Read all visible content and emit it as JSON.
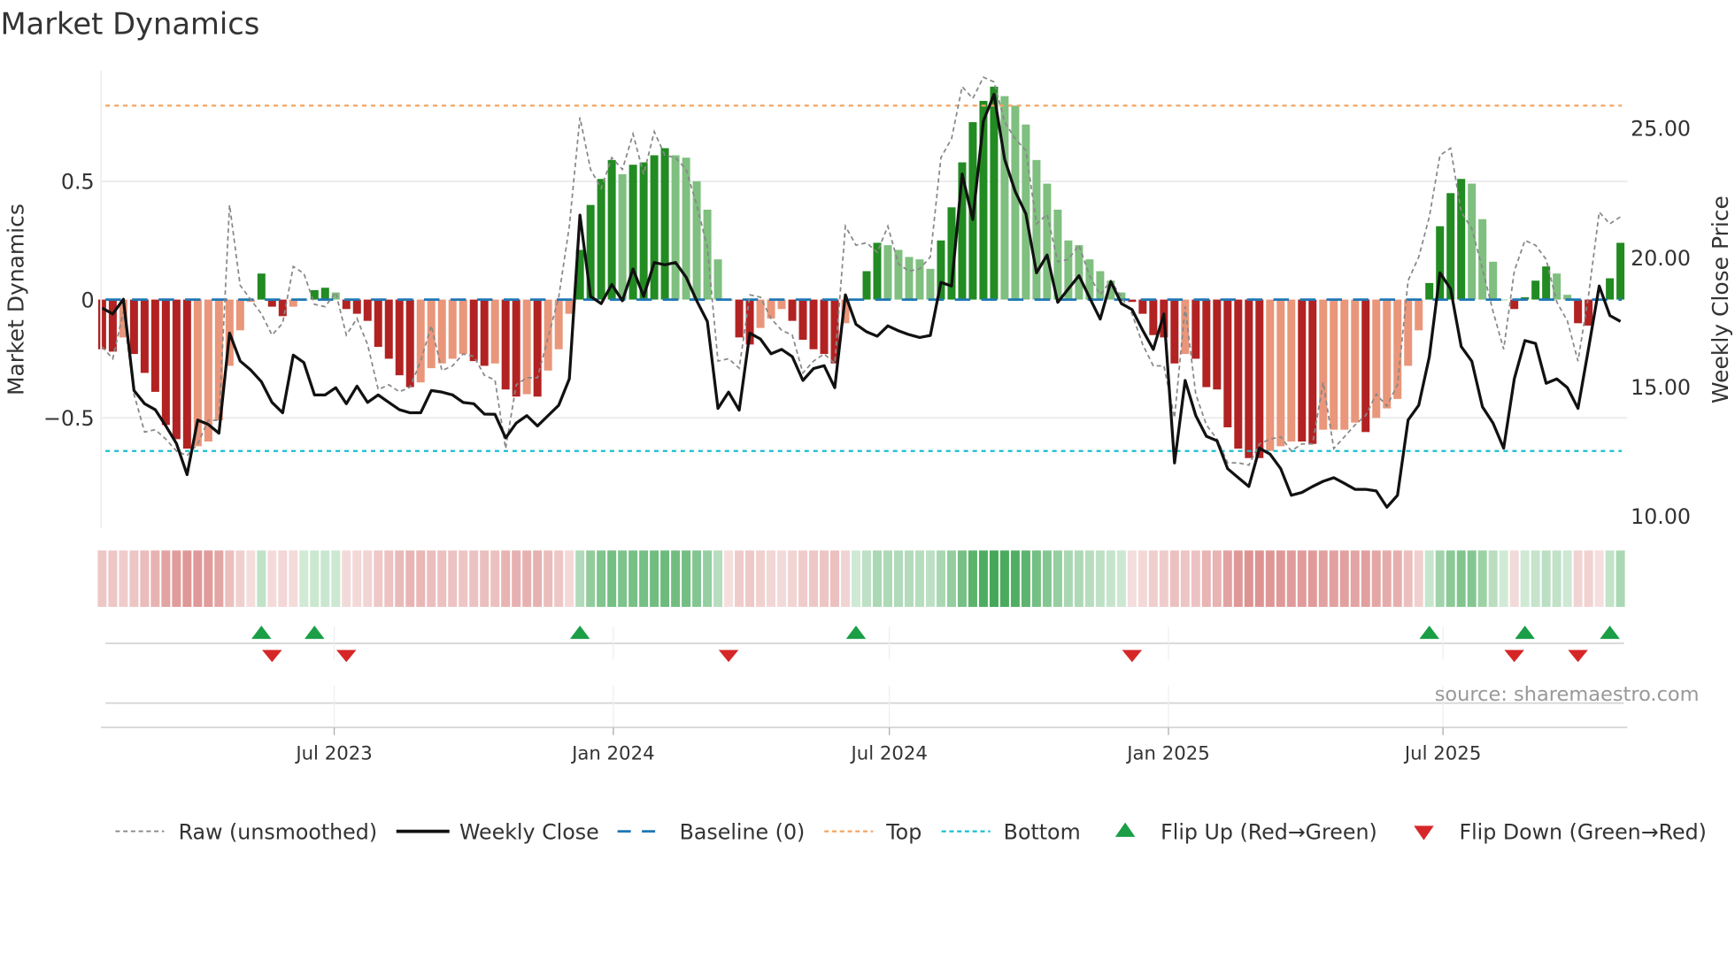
{
  "title": "Market Dynamics",
  "source": "source: sharemaestro.com",
  "colors": {
    "strong_red": "#b22222",
    "light_red": "#e9967a",
    "strong_green": "#228b22",
    "light_green": "#7fbf7f",
    "close": "#111111",
    "raw": "#888888",
    "baseline": "#1f77b4",
    "top": "#f4a460",
    "bottom": "#17becf",
    "flip_up": "#1a9e46",
    "flip_down": "#d62728"
  },
  "legend": [
    {
      "key": "raw",
      "label": "Raw (unsmoothed)"
    },
    {
      "key": "close",
      "label": "Weekly Close"
    },
    {
      "key": "baseline",
      "label": "Baseline (0)"
    },
    {
      "key": "top",
      "label": "Top"
    },
    {
      "key": "bottom",
      "label": "Bottom"
    },
    {
      "key": "flip_up",
      "label": "Flip Up (Red→Green)"
    },
    {
      "key": "flip_down",
      "label": "Flip Down (Green→Red)"
    }
  ],
  "chart_data": {
    "type": "bar",
    "title": "Market Dynamics",
    "ylabel": "Market Dynamics",
    "y2label": "Weekly Close Price",
    "ylim": [
      -0.97,
      0.97
    ],
    "y2lim": [
      9.53,
      27.22
    ],
    "yticks": [
      {
        "v": 0.5,
        "label": "0.5"
      },
      {
        "v": 0,
        "label": "0"
      },
      {
        "v": -0.5,
        "label": "−0.5"
      }
    ],
    "y2ticks": [
      {
        "v": 25,
        "label": "25.00"
      },
      {
        "v": 20,
        "label": "20.00"
      },
      {
        "v": 15,
        "label": "15.00"
      },
      {
        "v": 10,
        "label": "10.00"
      }
    ],
    "xticks": [
      {
        "date": "2023-07-01",
        "label": "Jul 2023"
      },
      {
        "date": "2024-01-01",
        "label": "Jan 2024"
      },
      {
        "date": "2024-07-01",
        "label": "Jul 2024"
      },
      {
        "date": "2025-01-01",
        "label": "Jan 2025"
      },
      {
        "date": "2025-07-01",
        "label": "Jul 2025"
      }
    ],
    "start_date": "2023-01-29",
    "frequency": "weekly",
    "top_level": 0.82,
    "bottom_level": -0.64,
    "baseline": 0,
    "values": [
      -0.21,
      -0.22,
      -0.16,
      -0.23,
      -0.31,
      -0.39,
      -0.53,
      -0.59,
      -0.63,
      -0.62,
      -0.6,
      -0.51,
      -0.28,
      -0.13,
      -0.01,
      0.11,
      -0.03,
      -0.07,
      -0.03,
      0.0,
      0.04,
      0.05,
      0.03,
      -0.04,
      -0.06,
      -0.09,
      -0.2,
      -0.25,
      -0.32,
      -0.37,
      -0.35,
      -0.29,
      -0.27,
      -0.25,
      -0.23,
      -0.26,
      -0.28,
      -0.27,
      -0.38,
      -0.41,
      -0.4,
      -0.41,
      -0.3,
      -0.21,
      -0.06,
      0.21,
      0.4,
      0.51,
      0.59,
      0.53,
      0.57,
      0.58,
      0.61,
      0.64,
      0.61,
      0.6,
      0.5,
      0.38,
      0.17,
      -0.003,
      -0.16,
      -0.19,
      -0.12,
      -0.08,
      -0.04,
      -0.09,
      -0.17,
      -0.21,
      -0.23,
      -0.27,
      -0.1,
      0.003,
      0.12,
      0.24,
      0.23,
      0.21,
      0.18,
      0.17,
      0.13,
      0.25,
      0.39,
      0.58,
      0.75,
      0.84,
      0.9,
      0.86,
      0.82,
      0.74,
      0.59,
      0.49,
      0.38,
      0.25,
      0.23,
      0.17,
      0.12,
      0.08,
      0.03,
      -0.01,
      -0.06,
      -0.15,
      -0.16,
      -0.27,
      -0.23,
      -0.25,
      -0.37,
      -0.38,
      -0.54,
      -0.63,
      -0.67,
      -0.67,
      -0.64,
      -0.62,
      -0.6,
      -0.6,
      -0.61,
      -0.55,
      -0.55,
      -0.55,
      -0.52,
      -0.56,
      -0.5,
      -0.46,
      -0.42,
      -0.28,
      -0.13,
      0.07,
      0.31,
      0.45,
      0.51,
      0.49,
      0.34,
      0.16,
      0.0,
      -0.04,
      0.01,
      0.08,
      0.14,
      0.11,
      0.02,
      -0.1,
      -0.11,
      -0.002,
      0.09,
      0.24
    ],
    "strong": [
      1,
      1,
      0,
      1,
      1,
      1,
      1,
      1,
      1,
      0,
      0,
      0,
      0,
      0,
      0,
      1,
      1,
      1,
      0,
      0,
      1,
      1,
      0,
      1,
      1,
      1,
      1,
      1,
      1,
      1,
      0,
      0,
      0,
      0,
      0,
      1,
      1,
      0,
      1,
      1,
      0,
      1,
      0,
      0,
      0,
      1,
      1,
      1,
      1,
      0,
      1,
      1,
      1,
      1,
      0,
      0,
      0,
      0,
      0,
      1,
      1,
      1,
      0,
      0,
      0,
      1,
      1,
      1,
      1,
      1,
      0,
      1,
      1,
      1,
      0,
      0,
      0,
      0,
      0,
      1,
      1,
      1,
      1,
      1,
      1,
      0,
      0,
      0,
      0,
      0,
      0,
      0,
      0,
      0,
      0,
      0,
      0,
      1,
      1,
      1,
      1,
      1,
      0,
      1,
      1,
      1,
      1,
      1,
      1,
      1,
      0,
      0,
      0,
      1,
      1,
      0,
      0,
      0,
      0,
      1,
      0,
      0,
      0,
      0,
      0,
      1,
      1,
      1,
      1,
      0,
      0,
      0,
      0,
      1,
      1,
      1,
      1,
      0,
      0,
      1,
      1,
      0,
      1,
      1
    ],
    "raw": [
      -0.2,
      -0.25,
      -0.05,
      -0.4,
      -0.56,
      -0.55,
      -0.59,
      -0.64,
      -0.66,
      -0.61,
      -0.51,
      -0.51,
      0.4,
      0.06,
      0.0,
      -0.06,
      -0.15,
      -0.1,
      0.14,
      0.11,
      -0.02,
      -0.03,
      0.03,
      -0.15,
      -0.08,
      -0.19,
      -0.38,
      -0.36,
      -0.39,
      -0.37,
      -0.26,
      -0.11,
      -0.3,
      -0.28,
      -0.23,
      -0.24,
      -0.32,
      -0.34,
      -0.63,
      -0.36,
      -0.33,
      -0.33,
      -0.16,
      0.01,
      0.31,
      0.77,
      0.55,
      0.47,
      0.6,
      0.55,
      0.7,
      0.53,
      0.71,
      0.61,
      0.6,
      0.55,
      0.4,
      0.22,
      -0.26,
      -0.25,
      -0.29,
      0.02,
      0.01,
      -0.08,
      -0.13,
      -0.15,
      -0.31,
      -0.26,
      -0.23,
      -0.27,
      0.31,
      0.23,
      0.24,
      0.2,
      0.31,
      0.15,
      0.12,
      0.13,
      0.18,
      0.6,
      0.68,
      0.9,
      0.85,
      0.94,
      0.92,
      0.75,
      0.68,
      0.63,
      0.32,
      0.36,
      0.16,
      0.17,
      0.23,
      0.1,
      0.02,
      0.08,
      0.01,
      -0.06,
      -0.19,
      -0.28,
      -0.28,
      -0.5,
      -0.03,
      -0.4,
      -0.53,
      -0.59,
      -0.69,
      -0.69,
      -0.7,
      -0.61,
      -0.59,
      -0.58,
      -0.64,
      -0.61,
      -0.61,
      -0.35,
      -0.63,
      -0.58,
      -0.53,
      -0.49,
      -0.4,
      -0.45,
      -0.36,
      0.08,
      0.18,
      0.35,
      0.61,
      0.64,
      0.37,
      0.3,
      0.13,
      -0.05,
      -0.21,
      0.12,
      0.25,
      0.23,
      0.17,
      -0.01,
      -0.09,
      -0.26,
      0.02,
      0.37,
      0.32,
      0.35
    ],
    "close": [
      18.05,
      17.82,
      18.39,
      14.86,
      14.35,
      14.12,
      13.49,
      12.81,
      11.61,
      13.72,
      13.55,
      13.21,
      17.08,
      16.0,
      15.65,
      15.2,
      14.4,
      14.0,
      16.23,
      15.94,
      14.69,
      14.69,
      14.97,
      14.35,
      15.03,
      14.4,
      14.69,
      14.4,
      14.12,
      14.0,
      14.0,
      14.86,
      14.8,
      14.69,
      14.4,
      14.35,
      13.95,
      13.94,
      13.03,
      13.6,
      13.89,
      13.49,
      13.89,
      14.29,
      15.31,
      21.64,
      18.5,
      18.22,
      18.96,
      18.33,
      19.56,
      18.5,
      19.81,
      19.72,
      19.81,
      19.24,
      18.33,
      17.53,
      14.17,
      14.8,
      14.1,
      17.08,
      16.85,
      16.28,
      16.45,
      16.17,
      15.25,
      15.71,
      15.82,
      14.97,
      18.56,
      17.42,
      17.13,
      16.96,
      17.36,
      17.17,
      17.02,
      16.91,
      16.99,
      19.04,
      18.9,
      23.23,
      21.47,
      25.28,
      26.31,
      23.8,
      22.55,
      21.69,
      19.41,
      20.1,
      18.27,
      18.79,
      19.3,
      18.45,
      17.62,
      19.07,
      18.22,
      17.99,
      17.19,
      16.45,
      17.82,
      12.06,
      15.25,
      13.89,
      13.09,
      12.92,
      11.84,
      11.49,
      11.15,
      12.63,
      12.4,
      11.84,
      10.81,
      10.92,
      11.15,
      11.35,
      11.49,
      11.27,
      11.04,
      11.04,
      10.98,
      10.35,
      10.81,
      13.72,
      14.29,
      16.17,
      19.41,
      18.79,
      16.56,
      15.99,
      14.23,
      13.6,
      12.63,
      15.31,
      16.79,
      16.68,
      15.14,
      15.31,
      14.97,
      14.17,
      16.5,
      18.9,
      17.76,
      17.53
    ],
    "flips": [
      {
        "week": 16,
        "dir": "up"
      },
      {
        "week": 17,
        "dir": "down"
      },
      {
        "week": 21,
        "dir": "up"
      },
      {
        "week": 24,
        "dir": "down"
      },
      {
        "week": 46,
        "dir": "up"
      },
      {
        "week": 60,
        "dir": "down"
      },
      {
        "week": 72,
        "dir": "up"
      },
      {
        "week": 98,
        "dir": "down"
      },
      {
        "week": 126,
        "dir": "up"
      },
      {
        "week": 134,
        "dir": "down"
      },
      {
        "week": 135,
        "dir": "up"
      },
      {
        "week": 140,
        "dir": "down"
      },
      {
        "week": 143,
        "dir": "up"
      }
    ],
    "legend_position": "bottom"
  }
}
